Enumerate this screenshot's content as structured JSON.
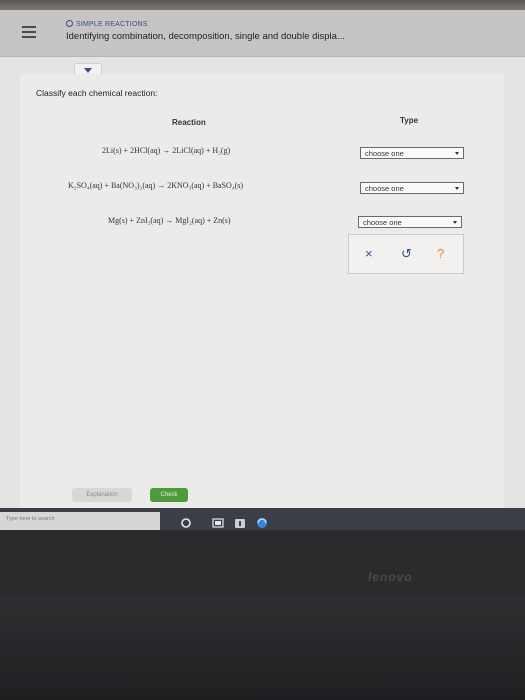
{
  "header": {
    "eyebrow": "SIMPLE REACTIONS",
    "title": "Identifying combination, decomposition, single and double displa..."
  },
  "prompt": "Classify each chemical reaction:",
  "columns": {
    "reaction": "Reaction",
    "type": "Type"
  },
  "rows": [
    {
      "reaction": "2Li(s) + 2HCl(aq) → 2LiCl(aq) + H₂(g)",
      "type": "choose one"
    },
    {
      "reaction": "K₂SO₄(aq) + Ba(NO₃)₂(aq) → 2KNO₃(aq) + BaSO₄(s)",
      "type": "choose one"
    },
    {
      "reaction": "Mg(s) + ZnI₂(aq) → MgI₂(aq) + Zn(s)",
      "type": "choose one"
    }
  ],
  "tools": {
    "clear": "×",
    "undo": "↺",
    "help": "?"
  },
  "buttons": {
    "explanation": "Explanation",
    "check": "Check"
  },
  "taskbar": {
    "search_placeholder": "Type here to search"
  },
  "brand": "lenovo",
  "colors": {
    "check_green": "#4f9a3c",
    "accent_blue": "#3a4f8a",
    "help_orange": "#e08a1e"
  }
}
